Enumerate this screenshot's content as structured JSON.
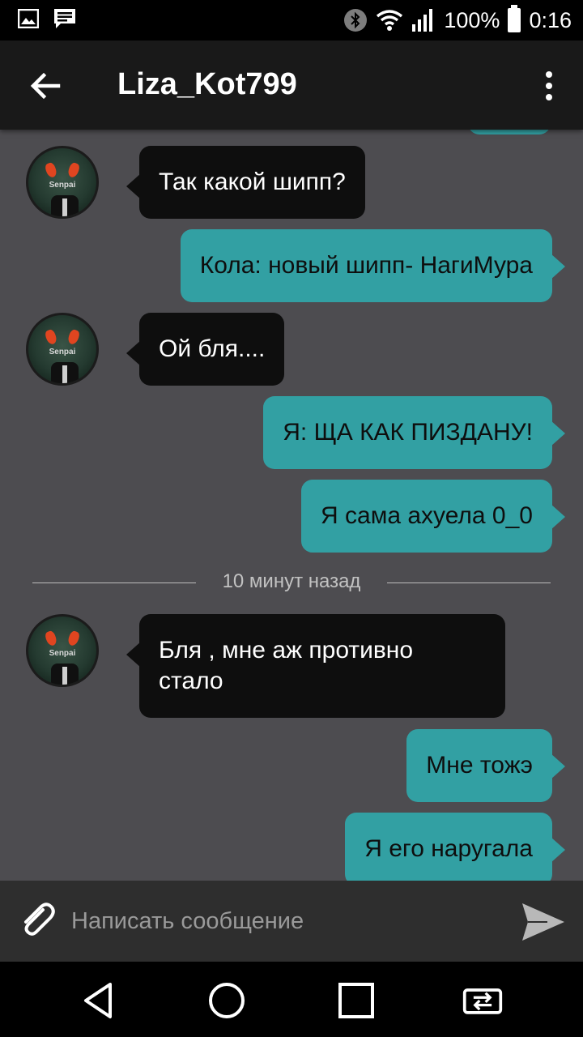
{
  "status_bar": {
    "battery_percent": "100%",
    "time": "0:16",
    "icons": [
      "image-notification-icon",
      "message-notification-icon",
      "bluetooth-icon",
      "wifi-icon",
      "signal-icon",
      "battery-icon"
    ]
  },
  "toolbar": {
    "title": "Liza_Kot799",
    "back_icon": "arrow-left-icon",
    "menu_icon": "more-vert-icon"
  },
  "messages": [
    {
      "direction": "in",
      "text": "Так какой шипп?"
    },
    {
      "direction": "out",
      "text": "Кола: новый шипп- НагиМура"
    },
    {
      "direction": "in",
      "text": "Ой бля...."
    },
    {
      "direction": "out",
      "text": "Я: ЩА КАК ПИЗДАНУ!"
    },
    {
      "direction": "out",
      "text": "Я сама ахуела 0_0"
    },
    {
      "direction": "in",
      "text": "Бля , мне аж противно\nстало"
    },
    {
      "direction": "out",
      "text": "Мне тожэ"
    },
    {
      "direction": "out",
      "text": "Я его наругала"
    }
  ],
  "time_divider": "10 минут назад",
  "avatar_caption": "Senpai",
  "input": {
    "placeholder": "Написать сообщение",
    "attach_icon": "paperclip-icon",
    "send_icon": "send-icon"
  },
  "nav": [
    "back-triangle-icon",
    "home-circle-icon",
    "recents-square-icon",
    "switch-app-icon"
  ],
  "colors": {
    "chat_background": "#4d4c50",
    "incoming_bubble": "#0e0e0e",
    "outgoing_bubble": "#32a0a3",
    "toolbar": "#191919",
    "input_bar": "#2e2e2e"
  }
}
